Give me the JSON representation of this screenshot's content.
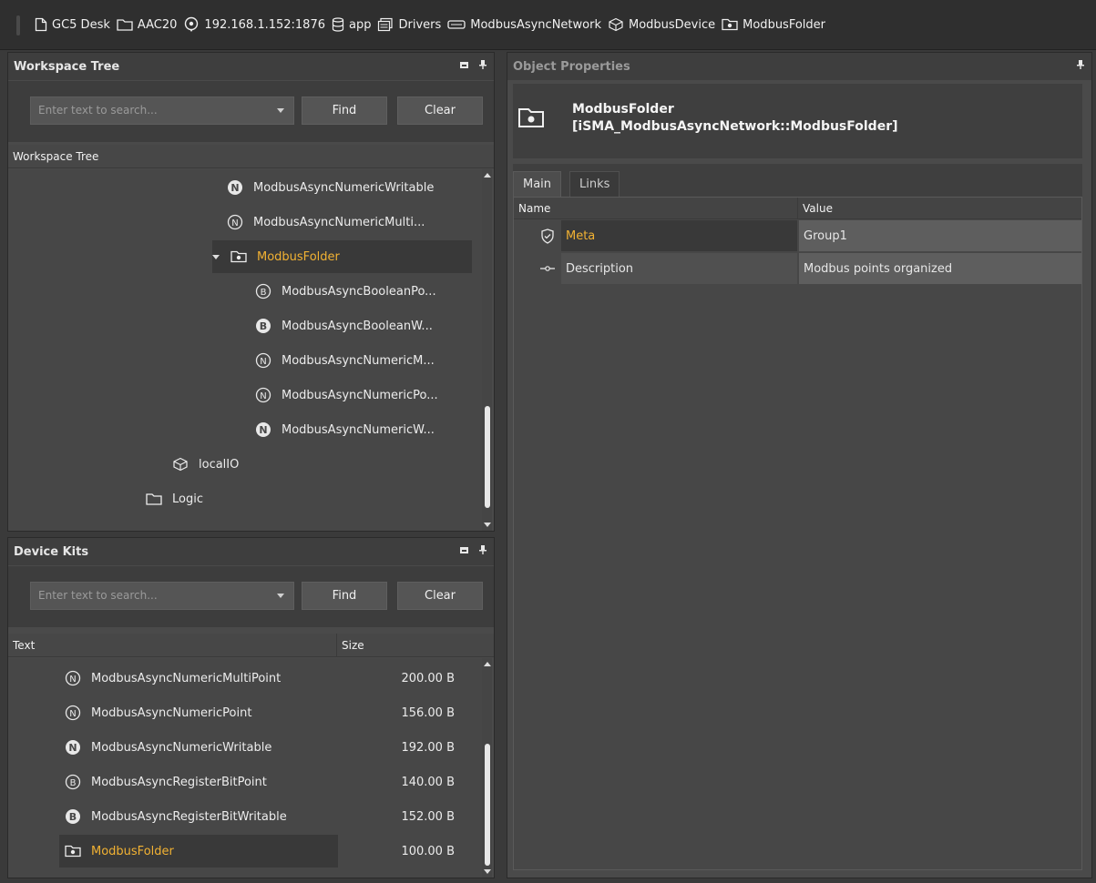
{
  "breadcrumb": [
    {
      "label": "GC5 Desk",
      "icon": "page-icon"
    },
    {
      "label": "AAC20",
      "icon": "folder-icon"
    },
    {
      "label": "192.168.1.152:1876",
      "icon": "station-icon"
    },
    {
      "label": "app",
      "icon": "database-icon"
    },
    {
      "label": "Drivers",
      "icon": "drivers-icon"
    },
    {
      "label": "ModbusAsyncNetwork",
      "icon": "network-icon"
    },
    {
      "label": "ModbusDevice",
      "icon": "device-icon"
    },
    {
      "label": "ModbusFolder",
      "icon": "modbus-folder-icon"
    }
  ],
  "workspace": {
    "title": "Workspace Tree",
    "search_placeholder": "Enter text to search...",
    "find_label": "Find",
    "clear_label": "Clear",
    "column_header": "Workspace Tree",
    "items": [
      {
        "label": "ModbusAsyncNumericWritable",
        "icon": "numeric-writable-icon"
      },
      {
        "label": "ModbusAsyncNumericMulti...",
        "icon": "numeric-point-icon"
      },
      {
        "label": "ModbusFolder",
        "icon": "modbus-folder-icon",
        "selected": true,
        "expanded": true
      },
      {
        "label": "ModbusAsyncBooleanPo...",
        "icon": "boolean-point-icon"
      },
      {
        "label": "ModbusAsyncBooleanW...",
        "icon": "boolean-writable-icon"
      },
      {
        "label": "ModbusAsyncNumericM...",
        "icon": "numeric-point-icon"
      },
      {
        "label": "ModbusAsyncNumericPo...",
        "icon": "numeric-point-icon"
      },
      {
        "label": "ModbusAsyncNumericW...",
        "icon": "numeric-writable-icon"
      },
      {
        "label": "localIO",
        "icon": "device-icon"
      },
      {
        "label": "Logic",
        "icon": "folder-icon"
      }
    ]
  },
  "device_kits": {
    "title": "Device Kits",
    "search_placeholder": "Enter text to search...",
    "find_label": "Find",
    "clear_label": "Clear",
    "col_text": "Text",
    "col_size": "Size",
    "items": [
      {
        "label": "ModbusAsyncNumericMultiPoint",
        "size": "200.00 B",
        "icon": "numeric-point-icon"
      },
      {
        "label": "ModbusAsyncNumericPoint",
        "size": "156.00 B",
        "icon": "numeric-point-icon"
      },
      {
        "label": "ModbusAsyncNumericWritable",
        "size": "192.00 B",
        "icon": "numeric-writable-icon"
      },
      {
        "label": "ModbusAsyncRegisterBitPoint",
        "size": "140.00 B",
        "icon": "boolean-point-icon"
      },
      {
        "label": "ModbusAsyncRegisterBitWritable",
        "size": "152.00 B",
        "icon": "boolean-writable-icon"
      },
      {
        "label": "ModbusFolder",
        "size": "100.00 B",
        "icon": "modbus-folder-icon",
        "selected": true
      }
    ]
  },
  "object_properties": {
    "title": "Object Properties",
    "object_name": "ModbusFolder",
    "object_type": "[iSMA_ModbusAsyncNetwork::ModbusFolder]",
    "tabs": [
      "Main",
      "Links"
    ],
    "col_name": "Name",
    "col_value": "Value",
    "rows": [
      {
        "name": "Meta",
        "value": "Group1",
        "icon": "shield-check-icon",
        "highlight": true
      },
      {
        "name": "Description",
        "value": "Modbus points organized",
        "icon": "link-slot-icon",
        "highlight": false
      }
    ]
  },
  "colors": {
    "selected_text": "#f2b233",
    "panel_bg": "#474747",
    "header_bg": "#3e3e3e",
    "breadcrumb_bg": "#2f2f2f"
  }
}
